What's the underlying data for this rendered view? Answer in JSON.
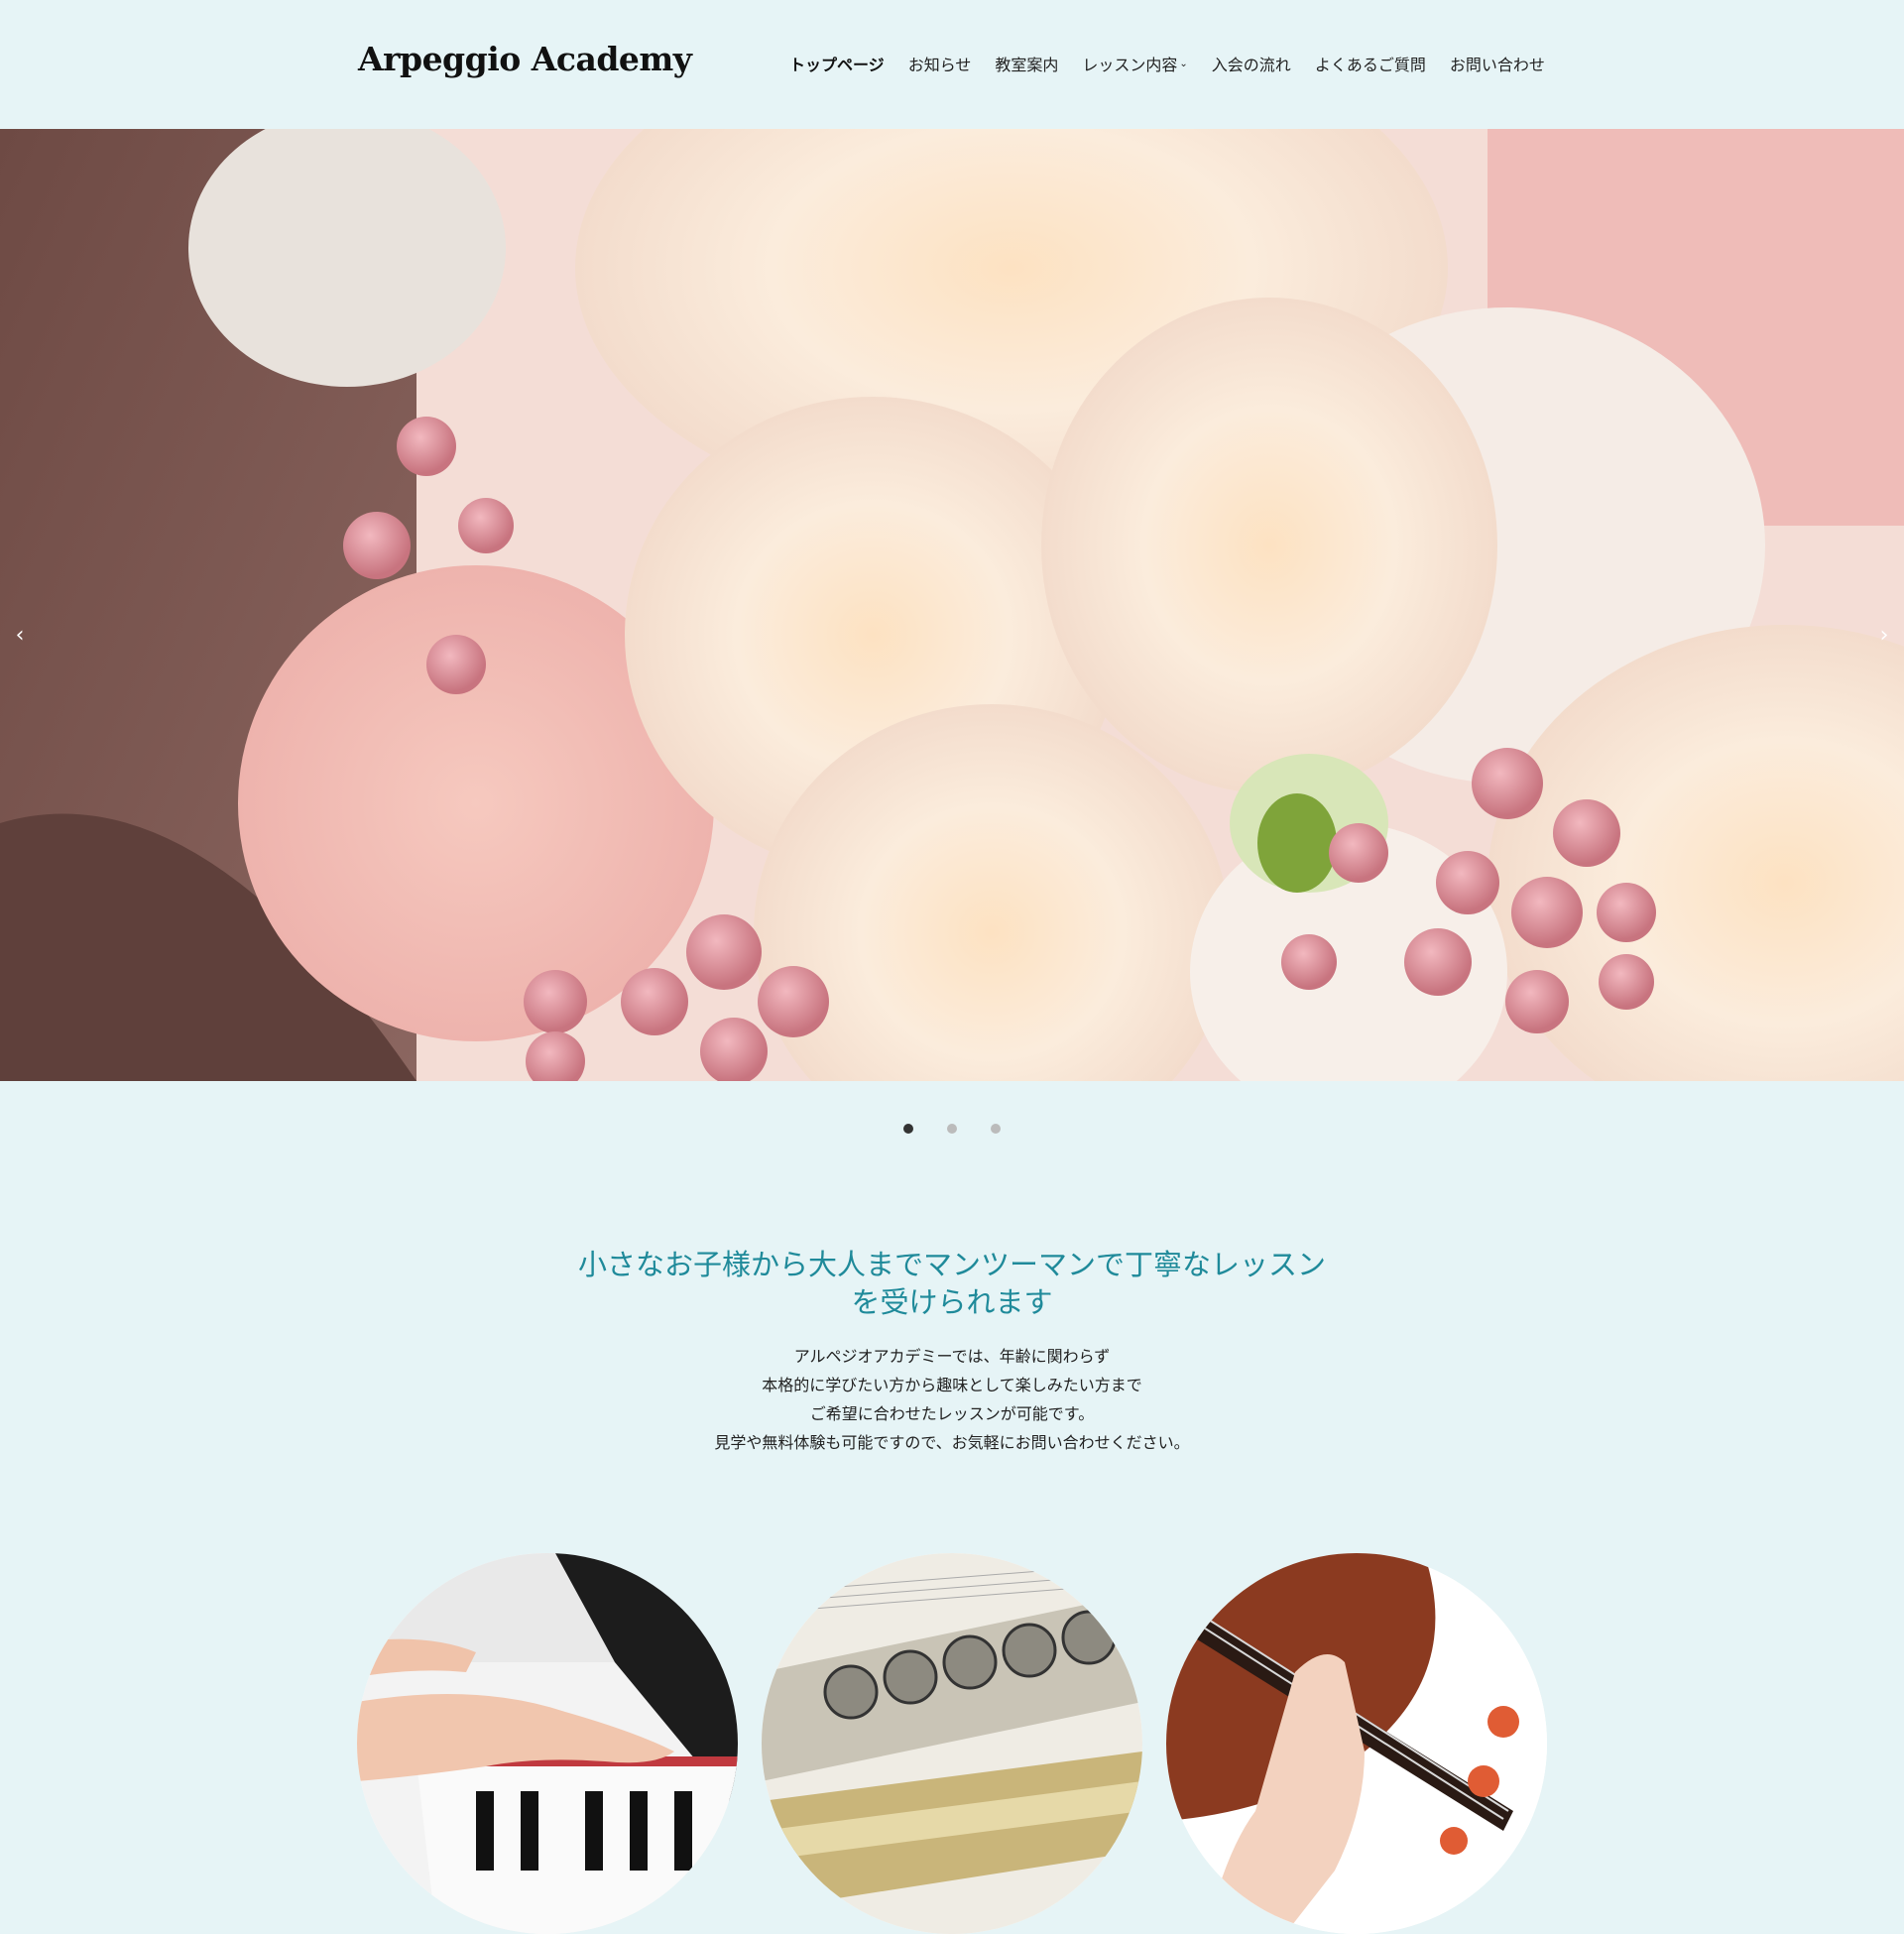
{
  "header": {
    "logo": "Arpeggio Academy",
    "nav": [
      {
        "label": "トップページ",
        "active": true
      },
      {
        "label": "お知らせ"
      },
      {
        "label": "教室案内"
      },
      {
        "label": "レッスン内容",
        "dropdown": true
      },
      {
        "label": "入会の流れ"
      },
      {
        "label": "よくあるご質問"
      },
      {
        "label": "お問い合わせ"
      }
    ]
  },
  "hero": {
    "prev_icon": "chevron-left-icon",
    "next_icon": "chevron-right-icon",
    "slide_count": 3,
    "active_slide": 1
  },
  "intro": {
    "heading_line1": "小さなお子様から大人までマンツーマンで丁寧なレッスン",
    "heading_line2": "を受けられます",
    "body": [
      "アルペジオアカデミーでは、年齢に関わらず",
      "本格的に学びたい方から趣味として楽しみたい方まで",
      "ご希望に合わせたレッスンが可能です。",
      "見学や無料体験も可能ですので、お気軽にお問い合わせください。"
    ]
  },
  "colors": {
    "background": "#e6f4f6",
    "heading": "#1f8a9a",
    "text": "#222222"
  }
}
